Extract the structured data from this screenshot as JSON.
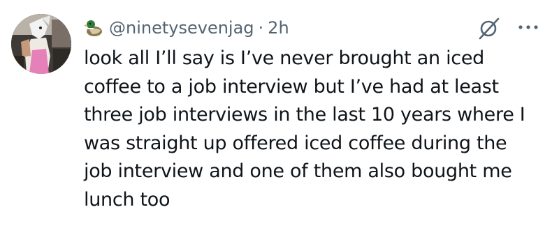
{
  "post": {
    "handle": "@ninetysevenjag",
    "separator": "·",
    "time": "2h",
    "text": "look all I’ll say is I’ve never brought an iced\ncoffee to a job interview but I’ve had at least\nthree job interviews in the last 10 years where I\nwas straight up offered iced coffee during the\njob interview and one of them also bought me\nlunch too"
  },
  "icons": {
    "flair": "duck-emoji",
    "filter": "filter-slash-icon",
    "more": "more-horizontal-icon",
    "avatar": "user-avatar-photo"
  },
  "colors": {
    "text": "#0f1419",
    "secondary": "#536471",
    "background": "#ffffff"
  }
}
